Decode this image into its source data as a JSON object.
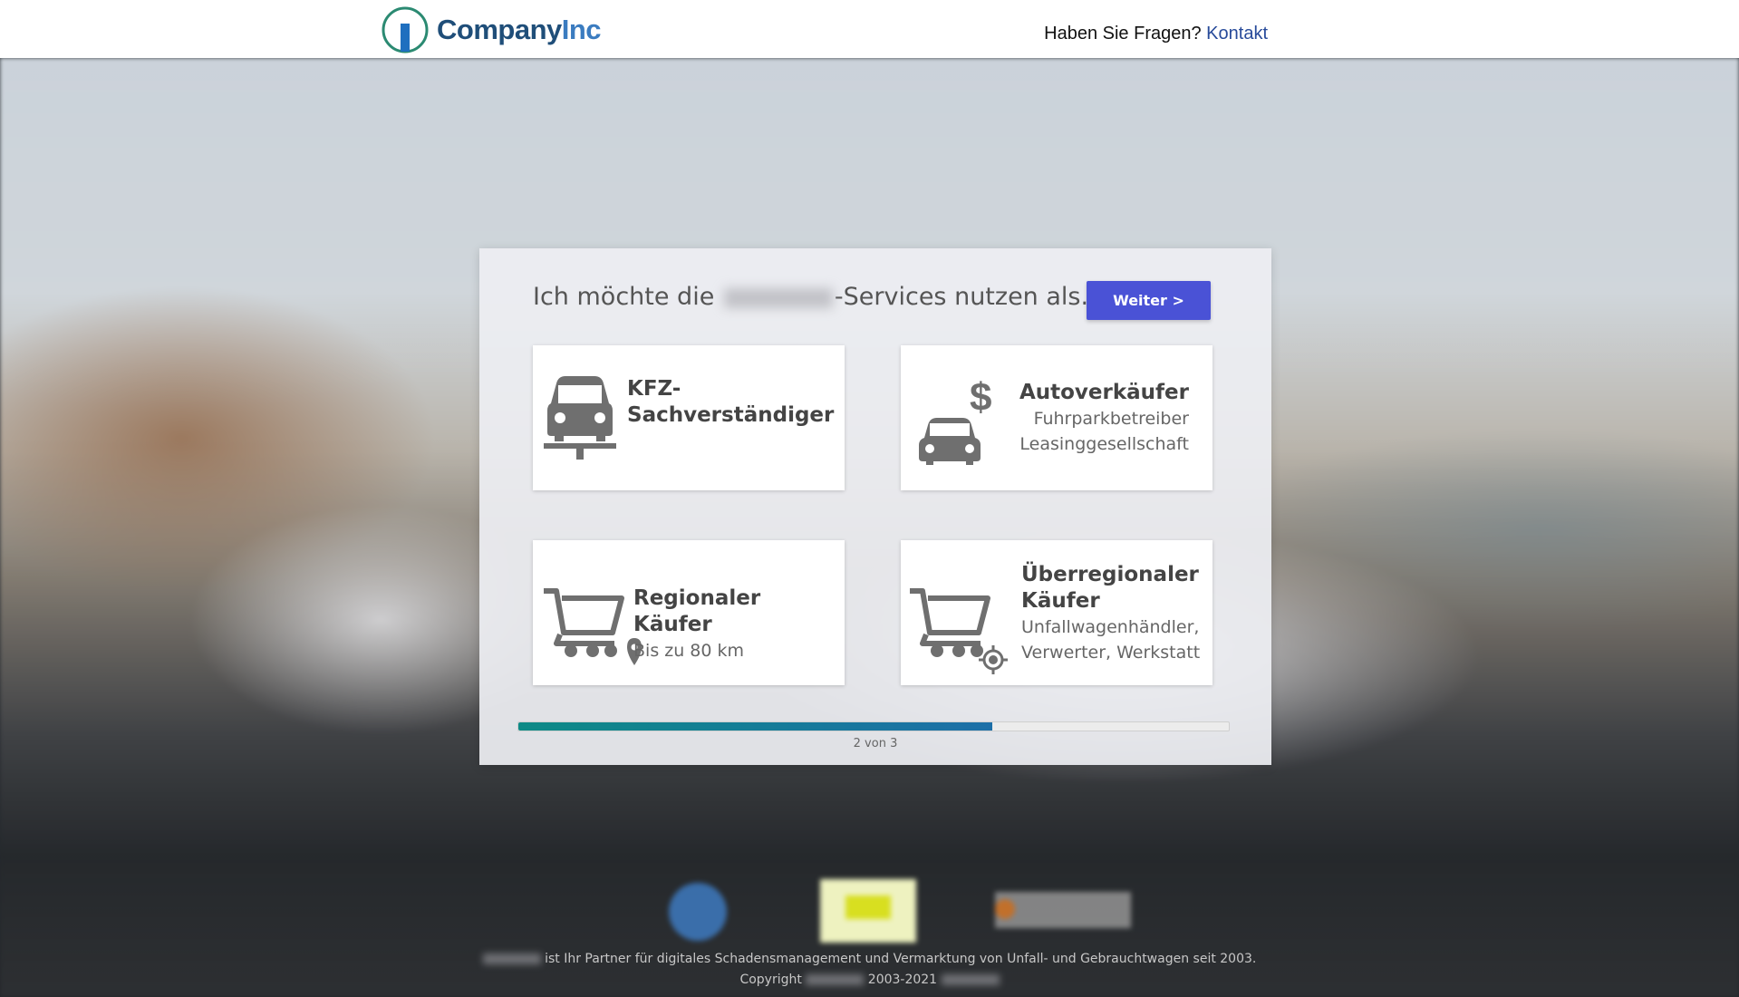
{
  "header": {
    "logo_company": "Company",
    "logo_inc": "Inc",
    "help_text": "Haben Sie Fragen?",
    "contact_link": "Kontakt"
  },
  "panel": {
    "heading_prefix": "Ich möchte die",
    "heading_suffix": "-Services nutzen als...",
    "next_button": "Weiter >",
    "options": [
      {
        "title": "KFZ-Sachverständiger",
        "icon": "car-lift-icon"
      },
      {
        "title": "Autoverkäufer",
        "lines": [
          "Fuhrparkbetreiber",
          "Leasinggesellschaft"
        ],
        "icon": "car-dollar-icon"
      },
      {
        "title": "Regionaler Käufer",
        "lines": [
          "Bis zu 80 km"
        ],
        "icon": "cart-location-icon"
      },
      {
        "title": "Überregionaler Käufer",
        "lines": [
          "Unfallwagenhändler,",
          "Verwerter, Werkstatt"
        ],
        "icon": "cart-target-icon"
      }
    ],
    "progress": {
      "fraction": 0.667,
      "label": "2 von 3"
    }
  },
  "footer": {
    "line1": "ist Ihr Partner für digitales Schadensmanagement und Vermarktung von Unfall- und Gebrauchtwagen seit 2003.",
    "line2_prefix": "Copyright",
    "line2_years": "2003-2021"
  },
  "colors": {
    "accent_button": "#4a52d6",
    "progress_fill": "#0d8a86",
    "link": "#274a9a"
  }
}
